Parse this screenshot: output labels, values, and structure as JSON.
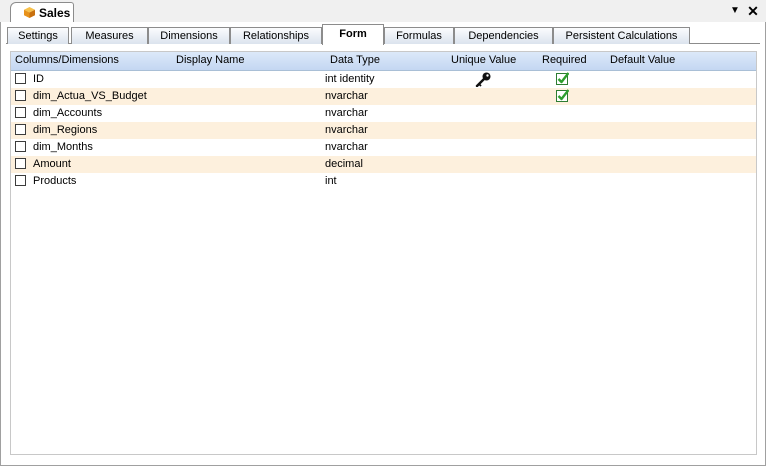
{
  "document": {
    "tab_title": "Sales",
    "dropdown_glyph": "▼",
    "close_glyph": "✕"
  },
  "tabs": [
    {
      "label": "Settings",
      "active": false
    },
    {
      "label": "Measures",
      "active": false
    },
    {
      "label": "Dimensions",
      "active": false
    },
    {
      "label": "Relationships",
      "active": false
    },
    {
      "label": "Form",
      "active": true
    },
    {
      "label": "Formulas",
      "active": false
    },
    {
      "label": "Dependencies",
      "active": false
    },
    {
      "label": "Persistent Calculations",
      "active": false
    }
  ],
  "grid": {
    "headers": {
      "columns": "Columns/Dimensions",
      "display_name": "Display Name",
      "data_type": "Data Type",
      "unique": "Unique Value",
      "required": "Required",
      "default": "Default Value"
    },
    "rows": [
      {
        "name": "ID",
        "display": "",
        "type": "int identity",
        "unique": true,
        "required": true,
        "checked": false
      },
      {
        "name": "dim_Actua_VS_Budget",
        "display": "",
        "type": "nvarchar",
        "unique": false,
        "required": true,
        "checked": false
      },
      {
        "name": "dim_Accounts",
        "display": "",
        "type": "nvarchar",
        "unique": false,
        "required": false,
        "checked": false
      },
      {
        "name": "dim_Regions",
        "display": "",
        "type": "nvarchar",
        "unique": false,
        "required": false,
        "checked": false
      },
      {
        "name": "dim_Months",
        "display": "",
        "type": "nvarchar",
        "unique": false,
        "required": false,
        "checked": false
      },
      {
        "name": "Amount",
        "display": "",
        "type": "decimal",
        "unique": false,
        "required": false,
        "checked": false
      },
      {
        "name": "Products",
        "display": "",
        "type": "int",
        "unique": false,
        "required": false,
        "checked": false
      }
    ]
  },
  "colors": {
    "header_bg": "#c4d7f2",
    "alt_row": "#fdf0dd",
    "check_green": "#2e9e2e",
    "cube_orange": "#f0a020"
  },
  "icons": {
    "unique": "key-icon",
    "required": "green-check-icon",
    "document": "cube-icon"
  }
}
